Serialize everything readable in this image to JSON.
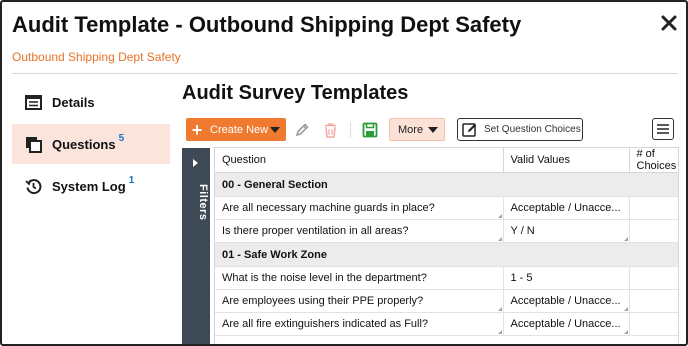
{
  "header": {
    "title": "Audit Template - Outbound Shipping Dept Safety",
    "subtitle": "Outbound Shipping Dept Safety",
    "close_icon": "close-icon"
  },
  "sidebar": {
    "items": [
      {
        "label": "Details",
        "icon": "list-icon",
        "count": "",
        "active": false
      },
      {
        "label": "Questions",
        "icon": "copy-icon",
        "count": "5",
        "active": true
      },
      {
        "label": "System Log",
        "icon": "history-icon",
        "count": "1",
        "active": false
      }
    ]
  },
  "main": {
    "title": "Audit Survey Templates",
    "toolbar": {
      "create_label": "Create New",
      "more_label": "More",
      "set_choices_label": "Set Question Choices",
      "icons": [
        "plus-icon",
        "pencil-icon",
        "trash-icon",
        "save-icon",
        "edit-note-icon",
        "menu-icon"
      ]
    },
    "filters_label": "Filters",
    "table": {
      "columns": [
        "Question",
        "Valid Values",
        "# of Choices"
      ],
      "groups": [
        {
          "name": "00 - General Section",
          "rows": [
            {
              "question": "Are all necessary machine guards in place?",
              "valid": "Acceptable / Unacce...",
              "choices": ""
            },
            {
              "question": "Is there proper ventilation in all areas?",
              "valid": "Y / N",
              "choices": ""
            }
          ]
        },
        {
          "name": "01 - Safe Work Zone",
          "rows": [
            {
              "question": "What is the noise level in the department?",
              "valid": "1 - 5",
              "choices": ""
            },
            {
              "question": "Are employees using their PPE properly?",
              "valid": "Acceptable / Unacce...",
              "choices": ""
            },
            {
              "question": "Are all fire extinguishers indicated as Full?",
              "valid": "Acceptable / Unacce...",
              "choices": ""
            }
          ]
        }
      ]
    }
  },
  "colors": {
    "accent": "#f07a2f",
    "active_nav": "#fbe4dc",
    "filters_bar": "#3d4a56",
    "count_blue": "#1a73c9"
  }
}
